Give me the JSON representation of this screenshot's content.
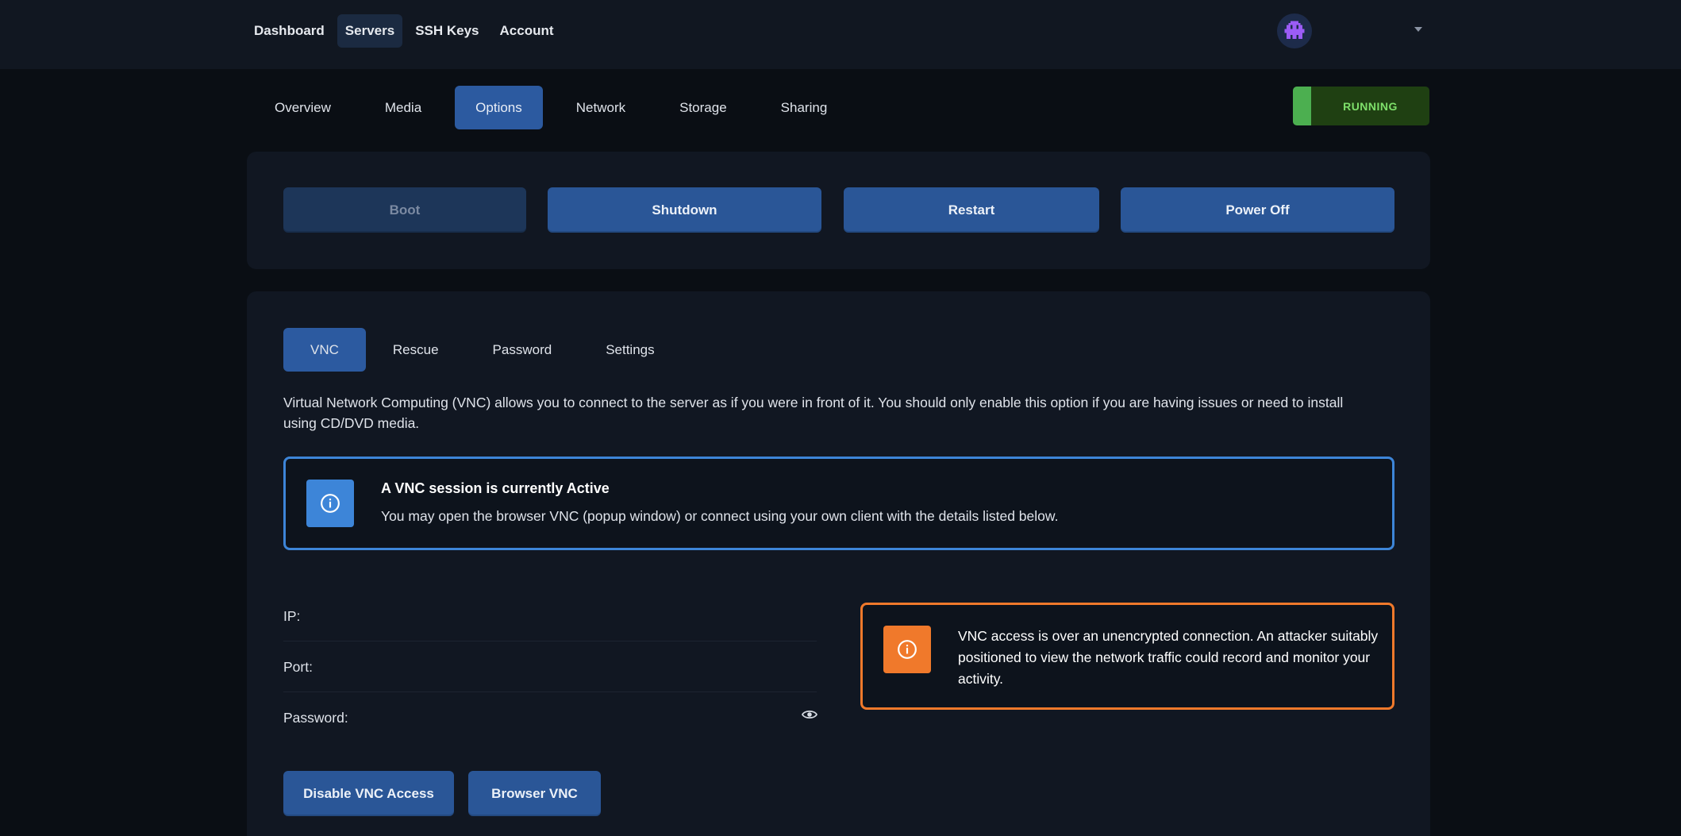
{
  "topnav": {
    "items": [
      {
        "label": "Dashboard"
      },
      {
        "label": "Servers"
      },
      {
        "label": "SSH Keys"
      },
      {
        "label": "Account"
      }
    ],
    "active_index": 1
  },
  "server_tabs": {
    "items": [
      {
        "label": "Overview"
      },
      {
        "label": "Media"
      },
      {
        "label": "Options"
      },
      {
        "label": "Network"
      },
      {
        "label": "Storage"
      },
      {
        "label": "Sharing"
      }
    ],
    "active_index": 2
  },
  "status": {
    "label": "RUNNING",
    "color": "#4caf50"
  },
  "power_actions": {
    "boot": "Boot",
    "shutdown": "Shutdown",
    "restart": "Restart",
    "power_off": "Power Off"
  },
  "option_tabs": {
    "items": [
      {
        "label": "VNC"
      },
      {
        "label": "Rescue"
      },
      {
        "label": "Password"
      },
      {
        "label": "Settings"
      }
    ],
    "active_index": 0
  },
  "vnc": {
    "description": "Virtual Network Computing (VNC) allows you to connect to the server as if you were in front of it. You should only enable this option if you are having issues or need to install using CD/DVD media.",
    "active_alert": {
      "title": "A VNC session is currently Active",
      "body": "You may open the browser VNC (popup window) or connect using your own client with the details listed below.",
      "icon": "info-icon"
    },
    "fields": {
      "ip_label": "IP:",
      "port_label": "Port:",
      "password_label": "Password:"
    },
    "warning": {
      "body": "VNC access is over an unencrypted connection. An attacker suitably positioned to view the network traffic could record and monitor your activity.",
      "icon": "info-icon"
    },
    "disable_button": "Disable VNC Access",
    "browser_button": "Browser VNC"
  },
  "colors": {
    "accent": "#2a5697",
    "info": "#3d85d8",
    "warning": "#f0792b",
    "running": "#4caf50"
  }
}
